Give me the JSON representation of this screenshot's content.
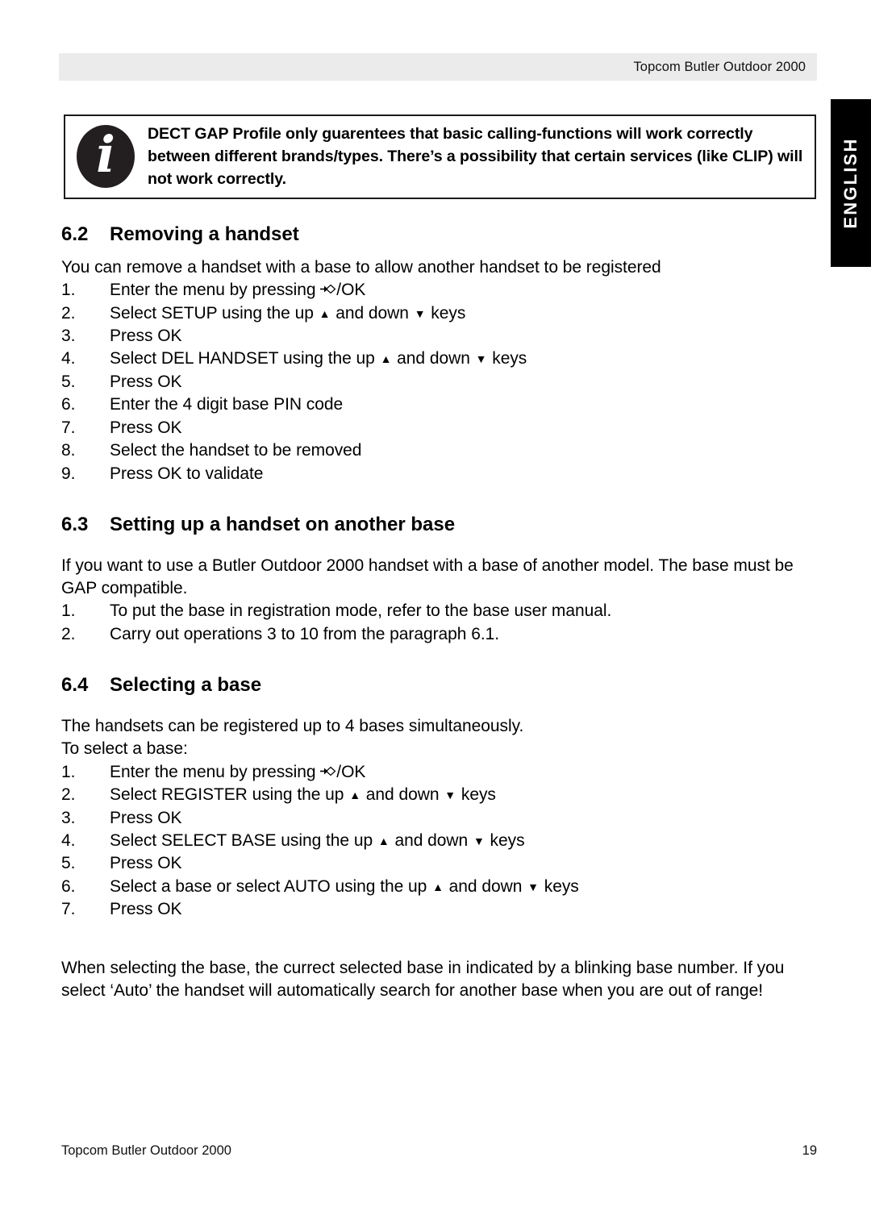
{
  "header": {
    "title": "Topcom Butler Outdoor 2000"
  },
  "language_tab": {
    "label": "ENGLISH"
  },
  "note_box": {
    "icon": "info-icon",
    "icon_glyph": "i",
    "text": "DECT GAP Profile only guarentees that basic calling-functions will work correctly between different brands/types. There’s a possibility  that certain services (like CLIP) will not work correctly."
  },
  "sections": [
    {
      "number": "6.2",
      "title": "Removing a handset",
      "intro": "You can remove a handset with a base to allow another handset to be registered",
      "steps": [
        {
          "index": "1.",
          "pre": "Enter the menu by pressing ",
          "glyph": "menu-ok-key",
          "post": "/OK"
        },
        {
          "index": "2.",
          "pre": "Select SETUP using the up ",
          "glyph": "up-down-keys",
          "post": " keys"
        },
        {
          "index": "3.",
          "pre": "Press OK",
          "glyph": "",
          "post": ""
        },
        {
          "index": "4.",
          "pre": "Select DEL HANDSET using the up ",
          "glyph": "up-down-keys",
          "post": " keys"
        },
        {
          "index": "5.",
          "pre": "Press OK",
          "glyph": "",
          "post": ""
        },
        {
          "index": "6.",
          "pre": "Enter the 4 digit base PIN code",
          "glyph": "",
          "post": ""
        },
        {
          "index": "7.",
          "pre": "Press OK",
          "glyph": "",
          "post": ""
        },
        {
          "index": "8.",
          "pre": "Select the handset to be removed",
          "glyph": "",
          "post": ""
        },
        {
          "index": "9.",
          "pre": "Press OK to validate",
          "glyph": "",
          "post": ""
        }
      ]
    },
    {
      "number": "6.3",
      "title": "Setting up a handset on another base",
      "intro": "If you want to use a Butler Outdoor 2000 handset with a base of another model. The base must be GAP compatible.",
      "steps": [
        {
          "index": "1.",
          "pre": "To put the base in registration mode, refer to the base user manual.",
          "glyph": "",
          "post": ""
        },
        {
          "index": "2.",
          "pre": "Carry out operations 3 to 10 from the paragraph 6.1.",
          "glyph": "",
          "post": ""
        }
      ]
    },
    {
      "number": "6.4",
      "title": "Selecting a base",
      "intro": "The handsets can be registered up to 4 bases simultaneously.",
      "intro2": "To select a base:",
      "steps": [
        {
          "index": "1.",
          "pre": "Enter the menu by pressing ",
          "glyph": "menu-ok-key",
          "post": "/OK"
        },
        {
          "index": "2.",
          "pre": "Select REGISTER using the up ",
          "glyph": "up-down-keys",
          "post": " keys"
        },
        {
          "index": "3.",
          "pre": "Press OK",
          "glyph": "",
          "post": ""
        },
        {
          "index": "4.",
          "pre": "Select SELECT BASE using the up ",
          "glyph": "up-down-keys",
          "post": " keys"
        },
        {
          "index": "5.",
          "pre": "Press OK",
          "glyph": "",
          "post": ""
        },
        {
          "index": "6.",
          "pre": "Select a base or select AUTO using the up ",
          "glyph": "up-down-keys",
          "post": " keys"
        },
        {
          "index": "7.",
          "pre": "Press OK",
          "glyph": "",
          "post": ""
        }
      ]
    }
  ],
  "closing_note": "When selecting the base, the currect selected base in indicated by a blinking base number. If you select ‘Auto’ the handset will automatically search for another base when you are out of range!",
  "inline_glyphs": {
    "middle_text": " and down ",
    "up_triangle": "▲",
    "down_triangle": "▼"
  },
  "footer": {
    "left": "Topcom Butler Outdoor 2000",
    "page_number": "19"
  }
}
